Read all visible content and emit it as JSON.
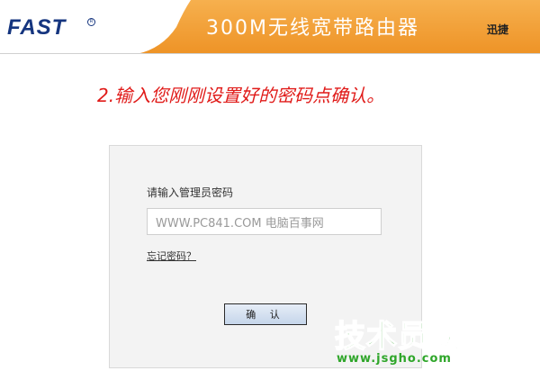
{
  "header": {
    "brand": "FAST",
    "brand_reg": "R",
    "product_title": "300M无线宽带路由器",
    "brand_tag": "迅捷",
    "colors": {
      "band": "#f2a23a",
      "brand": "#15357f"
    }
  },
  "instruction": "2.输入您刚刚设置好的密码点确认。",
  "login": {
    "label": "请输入管理员密码",
    "password_value": "WWW.PC841.COM 电脑百事网",
    "forgot_link": "忘记密码？",
    "confirm_button": "确 认"
  },
  "watermark": {
    "title": "技术员联盟",
    "url": "www.jsgho.com",
    "color": "#2fa62a"
  }
}
